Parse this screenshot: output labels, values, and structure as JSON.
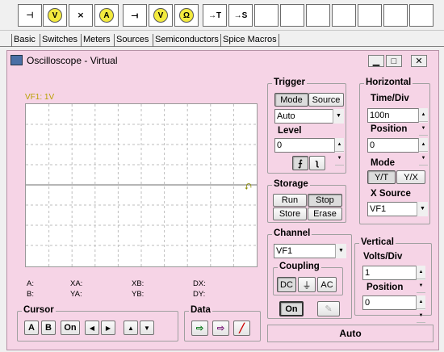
{
  "toolbar": {
    "items": [
      {
        "icon": "junction-icon",
        "glyph": "⊣"
      },
      {
        "icon": "voltmeter-icon",
        "glyph": "V"
      },
      {
        "icon": "switch-icon",
        "glyph": "⨯"
      },
      {
        "icon": "ammeter-icon",
        "glyph": "A"
      },
      {
        "icon": "wire-icon",
        "glyph": "⟞"
      },
      {
        "icon": "voltmeter-probe-icon",
        "glyph": "V"
      },
      {
        "icon": "ohmmeter-icon",
        "glyph": "Ω"
      },
      {
        "icon": "terminal-t-icon",
        "glyph": "→T"
      },
      {
        "icon": "terminal-s-icon",
        "glyph": "→S"
      }
    ]
  },
  "tabs": [
    "Basic",
    "Switches",
    "Meters",
    "Sources",
    "Semiconductors",
    "Spice Macros"
  ],
  "window": {
    "title": "Oscilloscope - Virtual",
    "minimize": "▁",
    "maximize": "□",
    "close": "✕"
  },
  "screen": {
    "channel_label": "VF1: 1V",
    "readouts": {
      "a": "A:",
      "b": "B:",
      "xa": "XA:",
      "ya": "YA:",
      "xb": "XB:",
      "yb": "YB:",
      "dx": "DX:",
      "dy": "DY:"
    }
  },
  "trigger": {
    "title": "Trigger",
    "mode_label": "Mode",
    "source_label": "Source",
    "mode_value": "Auto",
    "level_label": "Level",
    "level_value": "0",
    "rising_glyph": "⨍",
    "falling_glyph": "ʅ"
  },
  "horizontal": {
    "title": "Horizontal",
    "time_div_label": "Time/Div",
    "time_div_value": "100n",
    "position_label": "Position",
    "position_value": "0",
    "mode_label": "Mode",
    "yt_label": "Y/T",
    "yx_label": "Y/X",
    "xsource_label": "X Source",
    "xsource_value": "VF1"
  },
  "storage": {
    "title": "Storage",
    "run": "Run",
    "stop": "Stop",
    "store": "Store",
    "erase": "Erase"
  },
  "channel": {
    "title": "Channel",
    "value": "VF1",
    "coupling_label": "Coupling",
    "dc": "DC",
    "gnd": "⏚",
    "ac": "AC",
    "on_label": "On"
  },
  "vertical": {
    "title": "Vertical",
    "volts_div_label": "Volts/Div",
    "volts_div_value": "1",
    "position_label": "Position",
    "position_value": "0"
  },
  "cursor": {
    "title": "Cursor",
    "a": "A",
    "b": "B",
    "on": "On",
    "left": "◀",
    "right": "▶",
    "up": "▲",
    "down": "▼"
  },
  "data": {
    "title": "Data"
  },
  "status": {
    "auto": "Auto"
  },
  "colors": {
    "window_bg": "#f6d4e6",
    "trace_label": "#b8a000"
  }
}
